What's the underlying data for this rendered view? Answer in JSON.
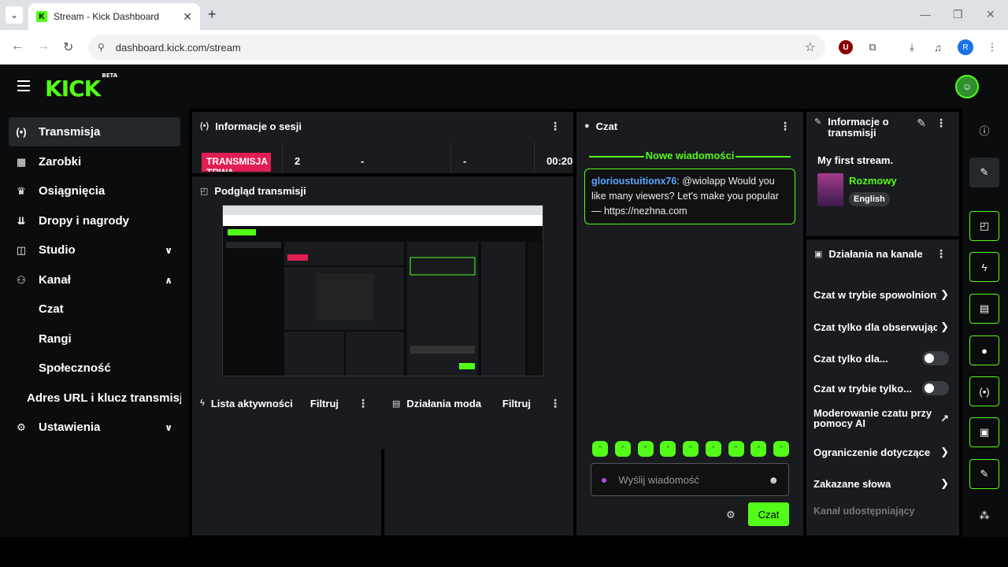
{
  "browser": {
    "tab_title": "Stream - Kick Dashboard",
    "tab_close": "✕",
    "new_tab": "+",
    "url": "dashboard.kick.com/stream",
    "profile_initial": "R",
    "window_controls": [
      "—",
      "❐",
      "✕"
    ]
  },
  "app": {
    "logo": "KICK",
    "logo_badge": "BETA"
  },
  "sidebar": {
    "items": [
      {
        "label": "Transmisja",
        "icon": "broadcast-icon",
        "glyph": "(•)",
        "active": true
      },
      {
        "label": "Zarobki",
        "icon": "earnings-icon",
        "glyph": "▦"
      },
      {
        "label": "Osiągnięcia",
        "icon": "trophy-icon",
        "glyph": "♛"
      },
      {
        "label": "Dropy i nagrody",
        "icon": "drops-icon",
        "glyph": "⇊"
      },
      {
        "label": "Studio",
        "icon": "studio-icon",
        "glyph": "◫",
        "chevron": "∨"
      },
      {
        "label": "Kanał",
        "icon": "channel-icon",
        "glyph": "⚇",
        "chevron": "∧"
      },
      {
        "label": "Ustawienia",
        "icon": "settings-icon",
        "glyph": "⚙",
        "chevron": "∨"
      }
    ],
    "sub_items": [
      "Czat",
      "Rangi",
      "Społeczność",
      "Adres URL i klucz transmisji"
    ]
  },
  "session": {
    "title": "Informacje o sesji",
    "live_label": "TRANSMISJA TRWA",
    "stats": [
      "2",
      "-",
      "-",
      "00:20"
    ]
  },
  "preview": {
    "title": "Podgląd transmisji"
  },
  "activity": {
    "title": "Lista aktywności",
    "filter": "Filtruj"
  },
  "modactions": {
    "title": "Działania moda",
    "filter": "Filtruj"
  },
  "chat": {
    "title": "Czat",
    "new_messages": "Nowe wiadomości",
    "message_user": "glorioustuitionx76",
    "message_text": ": @wiolapp Would you like many viewers? Let's make you popular — https://nezhna.com",
    "input_placeholder": "Wyślij wiadomość",
    "send_label": "Czat"
  },
  "stream_info": {
    "title": "Informacje o transmisji",
    "stream_title": "My first stream.",
    "category": "Rozmowy",
    "language": "English"
  },
  "channel_actions": {
    "title": "Działania na kanale",
    "items": [
      {
        "label": "Czat w trybie spowolnionym",
        "type": "chevron"
      },
      {
        "label": "Czat tylko dla obserwujących",
        "type": "chevron"
      },
      {
        "label": "Czat tylko dla...",
        "type": "toggle",
        "on": false
      },
      {
        "label": "Czat w trybie tylko...",
        "type": "toggle",
        "on": false
      },
      {
        "label": "Moderowanie czatu przy pomocy AI",
        "type": "external"
      },
      {
        "label": "Ograniczenie dotyczące",
        "type": "chevron"
      },
      {
        "label": "Zakazane słowa",
        "type": "chevron"
      },
      {
        "label": "Kanał udostępniający",
        "type": "disabled"
      }
    ]
  },
  "colors": {
    "accent": "#53fc18",
    "live": "#e01e53",
    "panel": "#191b1f",
    "username": "#5aa3ff"
  }
}
